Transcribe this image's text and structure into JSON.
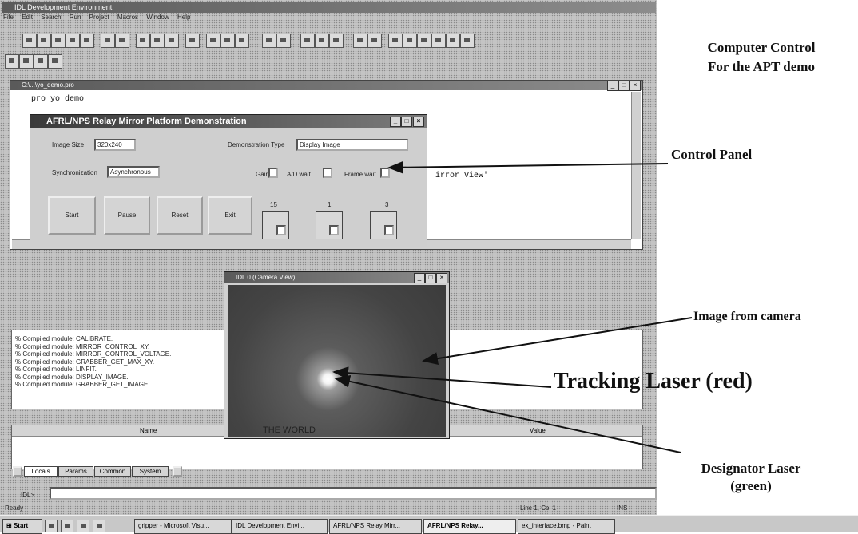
{
  "ide": {
    "window_title": "IDL Development Environment",
    "menu": [
      "File",
      "Edit",
      "Search",
      "Run",
      "Project",
      "Macros",
      "Window",
      "Help"
    ],
    "editor_title": "C:\\...\\yo_demo.pro",
    "editor_code": [
      "pro yo_demo",
      "irror View'"
    ],
    "output_lines": [
      "% Compiled module: CALIBRATE.",
      "% Compiled module: MIRROR_CONTROL_XY.",
      "% Compiled module: MIRROR_CONTROL_VOLTAGE.",
      "% Compiled module: GRABBER_GET_MAX_XY.",
      "% Compiled module: LINFIT.",
      "% Compiled module: DISPLAY_IMAGE.",
      "% Compiled module: GRABBER_GET_IMAGE."
    ],
    "variables_headers": [
      "Name",
      "Value"
    ],
    "tabs": [
      "Locals",
      "Params",
      "Common",
      "System"
    ],
    "command_prompt": "IDL>",
    "status_left": "Ready",
    "status_pos": "Line 1, Col 1",
    "status_ins": "INS"
  },
  "control_panel": {
    "title": "AFRL/NPS Relay Mirror Platform Demonstration",
    "image_size_label": "Image Size",
    "image_size_value": "320x240",
    "demo_type_label": "Demonstration Type",
    "demo_type_value": "Display Image",
    "sync_label": "Synchronization",
    "sync_value": "Asynchronous",
    "gain_label": "Gain",
    "ad_label": "A/D wait",
    "frame_label": "Frame wait",
    "gain_value": "15",
    "ad_value": "1",
    "frame_value": "3",
    "buttons": [
      "Start",
      "Pause",
      "Reset",
      "Exit"
    ]
  },
  "camera_window": {
    "title": "IDL 0 (Camera View)",
    "overlay_text": "THE WORLD"
  },
  "taskbar": {
    "start": "Start",
    "items": [
      "gripper - Microsoft Visu...",
      "IDL Development Envi...",
      "AFRL/NPS Relay Mirr...",
      "AFRL/NPS Relay...",
      "ex_interface.bmp - Paint"
    ]
  },
  "annotations": {
    "heading_line1": "Computer Control",
    "heading_line2": "For the APT demo",
    "control_panel": "Control Panel",
    "image_from_camera": "Image from camera",
    "tracking_laser": "Tracking Laser (red)",
    "designator_line1": "Designator Laser",
    "designator_line2": "(green)"
  },
  "colors": {
    "ide_background": "#c4c4c4",
    "title_bar": "#6a6a6a",
    "camera_bg": "#4a4a4a",
    "annotation_text": "#111111"
  }
}
